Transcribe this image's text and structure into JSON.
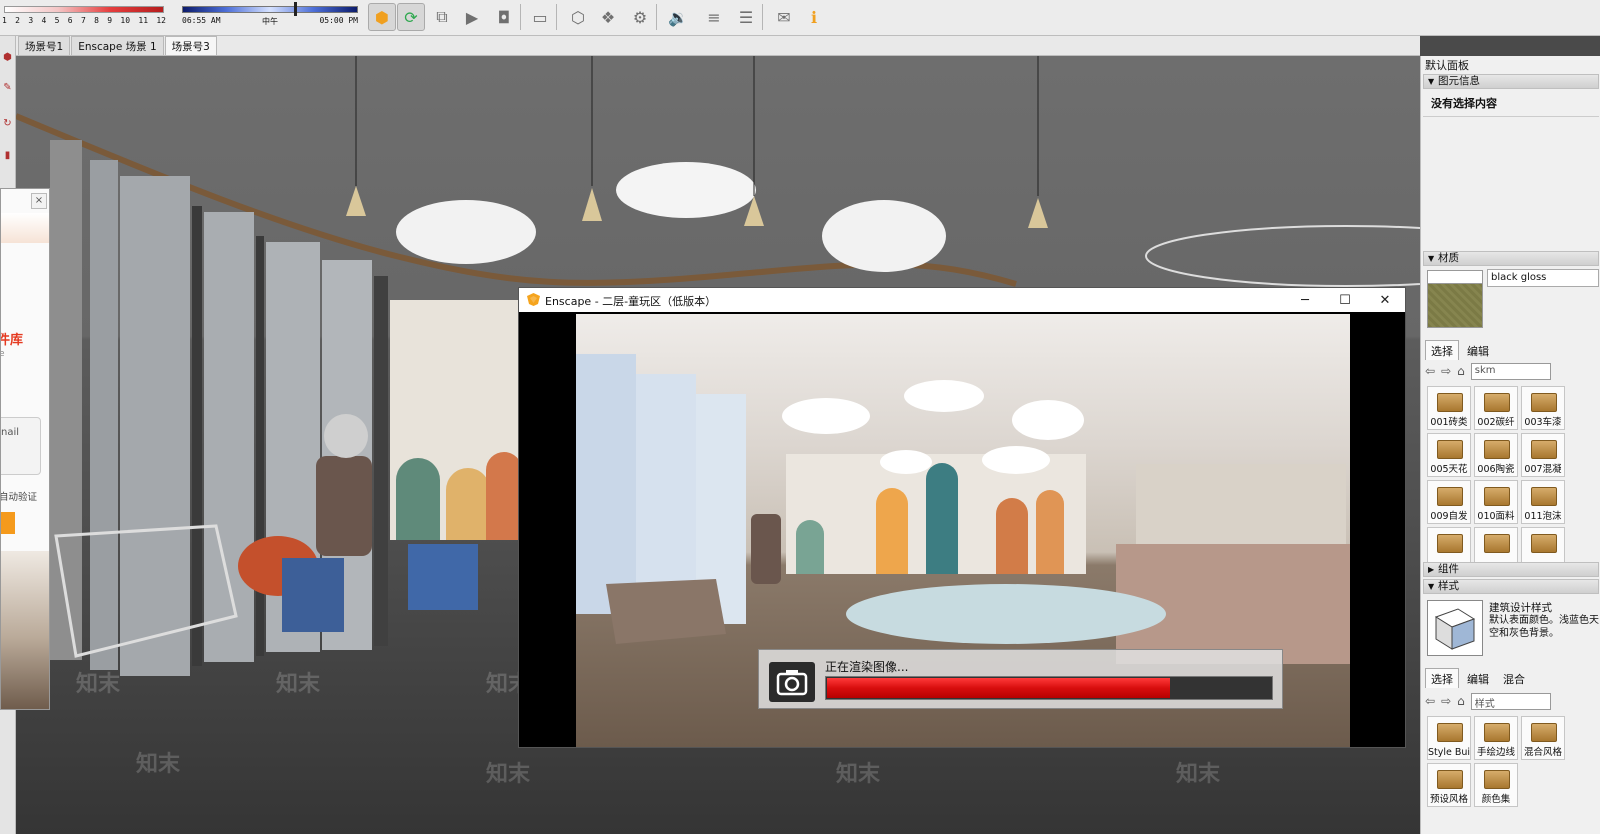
{
  "toolbar": {
    "month_labels": [
      "1",
      "2",
      "3",
      "4",
      "5",
      "6",
      "7",
      "8",
      "9",
      "10",
      "11",
      "12"
    ],
    "time_start": "06:55 AM",
    "time_mid": "中午",
    "time_end": "05:00 PM",
    "buttons": [
      {
        "name": "enscape-start-button",
        "icon": "enscape-logo"
      },
      {
        "name": "live-update-button",
        "icon": "sync-icon"
      },
      {
        "name": "sync-views-button",
        "icon": "camera-sync-icon"
      },
      {
        "name": "video-editor-button",
        "icon": "video-camera-icon"
      },
      {
        "name": "screenshot-button",
        "icon": "photo-camera-icon"
      },
      {
        "name": "vr-headset-button",
        "icon": "vr-headset-icon"
      },
      {
        "name": "asset-library-button",
        "icon": "asset-cube-icon"
      },
      {
        "name": "batch-render-button",
        "icon": "batch-render-icon"
      },
      {
        "name": "render-settings-button",
        "icon": "render-settings-icon"
      },
      {
        "name": "audio-button",
        "icon": "speaker-icon"
      },
      {
        "name": "visual-settings-button",
        "icon": "sliders-icon"
      },
      {
        "name": "general-settings-button",
        "icon": "adjust-icon"
      },
      {
        "name": "feedback-button",
        "icon": "chat-icon"
      },
      {
        "name": "about-button",
        "icon": "info-icon"
      }
    ]
  },
  "scene_tabs": [
    {
      "label": "场景号1",
      "active": false
    },
    {
      "label": "Enscape 场景 1",
      "active": false
    },
    {
      "label": "场景号3",
      "active": true
    }
  ],
  "left_dialog": {
    "title_fragment": "件库",
    "sub_fragment": "e",
    "input_fragment": "nail",
    "verify_fragment": "自动验证"
  },
  "enscape_window": {
    "title": "Enscape - 二层-童玩区（低版本）",
    "progress_label": "正在渲染图像...",
    "progress_fraction": 0.77
  },
  "right_panel": {
    "title": "默认面板",
    "entity_info_header": "图元信息",
    "entity_info_text": "没有选择内容",
    "materials_header": "材质",
    "material_name": "black gloss",
    "materials_tabs": [
      "选择",
      "编辑"
    ],
    "materials_search": "skm",
    "material_items": [
      "001砖类",
      "002碳纤",
      "003车漆",
      "005天花",
      "006陶瓷",
      "007混凝",
      "009自发",
      "010面料",
      "011泡沫",
      "",
      "",
      ""
    ],
    "components_header": "组件",
    "styles_header": "样式",
    "style_name": "建筑设计样式",
    "style_desc": "默认表面颜色。浅蓝色天空和灰色背景。",
    "styles_tabs": [
      "选择",
      "编辑",
      "混合"
    ],
    "styles_search": "样式",
    "style_items": [
      "Style Buil",
      "手绘边线",
      "混合风格",
      "预设风格",
      "颜色集"
    ]
  },
  "watermarks": [
    "知末",
    "知末",
    "知末",
    "知末",
    "知末",
    "知末",
    "知末",
    "知末"
  ],
  "colors": {
    "progress_red": "#d80e0e",
    "toolbar_bg": "#ececec",
    "panel_bg": "#f0f0f0"
  }
}
